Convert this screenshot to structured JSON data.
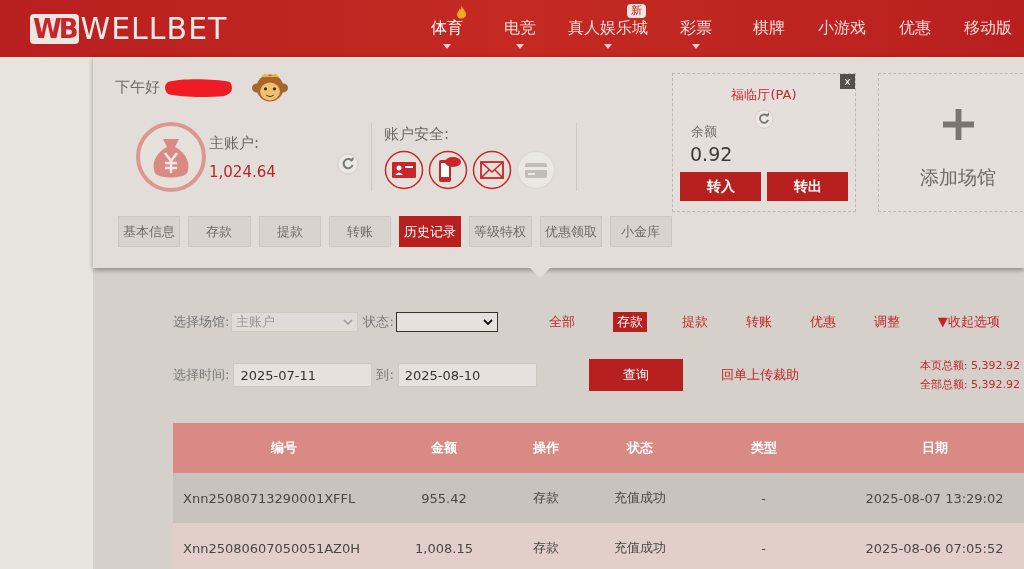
{
  "header": {
    "logo_mark": "WB",
    "logo_text": "WELLBET",
    "nav": [
      {
        "label": "体育",
        "selected": true,
        "has_menu": true,
        "hot": true
      },
      {
        "label": "电竞",
        "selected": false,
        "has_menu": true,
        "hot": false
      },
      {
        "label": "真人娱乐城",
        "selected": false,
        "has_menu": true,
        "hot": false,
        "badge": "新"
      },
      {
        "label": "彩票",
        "selected": false,
        "has_menu": true,
        "hot": false
      },
      {
        "label": "棋牌",
        "selected": false,
        "has_menu": false,
        "hot": false
      },
      {
        "label": "小游戏",
        "selected": false,
        "has_menu": false,
        "hot": false
      },
      {
        "label": "优惠",
        "selected": false,
        "has_menu": false,
        "hot": false
      },
      {
        "label": "移动版",
        "selected": false,
        "has_menu": false,
        "hot": false
      }
    ]
  },
  "account": {
    "greeting": "下午好",
    "main_label": "主账户:",
    "main_balance": "1,024.64",
    "security_label": "账户安全:",
    "security_icons": [
      {
        "kind": "id-card",
        "verified": true
      },
      {
        "kind": "sms",
        "verified": true
      },
      {
        "kind": "email",
        "verified": true
      },
      {
        "kind": "bank-card",
        "verified": false
      }
    ],
    "tabs": [
      {
        "label": "基本信息",
        "selected": false
      },
      {
        "label": "存款",
        "selected": false
      },
      {
        "label": "提款",
        "selected": false
      },
      {
        "label": "转账",
        "selected": false
      },
      {
        "label": "历史记录",
        "selected": true
      },
      {
        "label": "等级特权",
        "selected": false
      },
      {
        "label": "优惠领取",
        "selected": false
      },
      {
        "label": "小金库",
        "selected": false
      }
    ]
  },
  "venue_card": {
    "close": "x",
    "name": "福临厅(PA)",
    "balance_label": "余额",
    "balance": "0.92",
    "buttons": [
      "转入",
      "转出"
    ]
  },
  "add_venue": {
    "label": "添加场馆"
  },
  "filters": {
    "venue_label": "选择场馆:",
    "venue_value": "主账户",
    "status_label": "状态:",
    "types": [
      {
        "label": "全部",
        "selected": false
      },
      {
        "label": "存款",
        "selected": true
      },
      {
        "label": "提款",
        "selected": false
      },
      {
        "label": "转账",
        "selected": false
      },
      {
        "label": "优惠",
        "selected": false
      },
      {
        "label": "调整",
        "selected": false
      }
    ],
    "collapse_toggle": "▼收起选项",
    "time_label": "选择时间:",
    "date_from": "2025-07-11",
    "to_label": "到:",
    "date_to": "2025-08-10",
    "query_button": "查询",
    "upload_link": "回单上传裁助",
    "page_total": "本页总额: 5,392.92",
    "all_total": "全部总额: 5,392.92"
  },
  "table": {
    "columns": [
      "编号",
      "金额",
      "操作",
      "状态",
      "类型",
      "日期"
    ],
    "rows": [
      [
        "Xnn25080713290001XFFL",
        "955.42",
        "存款",
        "充值成功",
        "-",
        "2025-08-07 13:29:02"
      ],
      [
        "Xnn25080607050051AZ0H",
        "1,008.15",
        "存款",
        "充值成功",
        "-",
        "2025-08-06 07:05:52"
      ]
    ]
  }
}
